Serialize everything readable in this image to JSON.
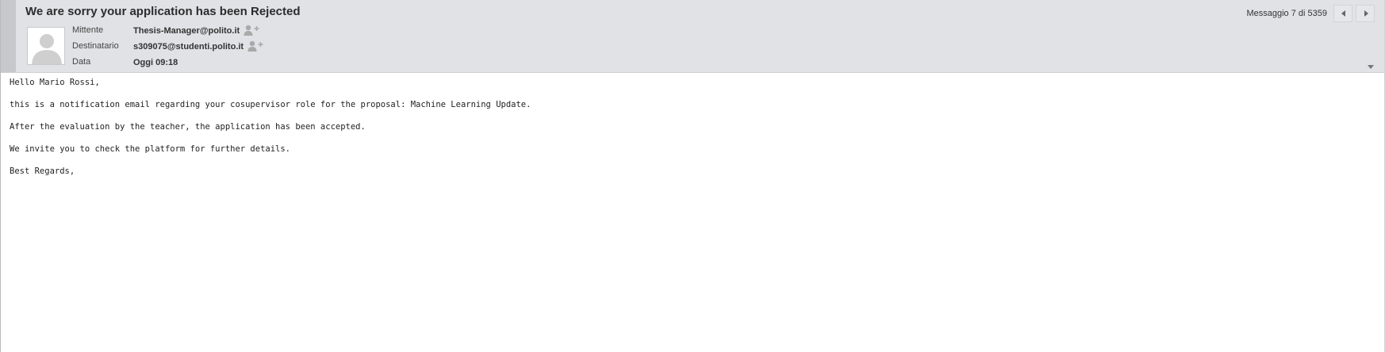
{
  "message": {
    "subject": "We are sorry your application has been Rejected",
    "fields": [
      {
        "label": "Mittente",
        "value": "Thesis-Manager@polito.it"
      },
      {
        "label": "Destinatario",
        "value": "s309075@studenti.polito.it"
      },
      {
        "label": "Data",
        "value": "Oggi 09:18"
      }
    ],
    "counter": "Messaggio 7 di 5359",
    "body": [
      "Hello Mario Rossi,",
      "this is a notification email regarding your cosupervisor role for the proposal: Machine Learning Update.",
      "After the evaluation by the teacher, the application has been accepted.",
      "We invite you to check the platform for further details.",
      "Best Regards,"
    ]
  },
  "icons": {
    "avatar": "user-silhouette",
    "add_contact": "add-contact-icon",
    "prev": "triangle-left",
    "next": "triangle-right",
    "expand": "triangle-down"
  },
  "colors": {
    "header_bg": "#e1e2e6",
    "header_strip": "#c7c8cc"
  }
}
